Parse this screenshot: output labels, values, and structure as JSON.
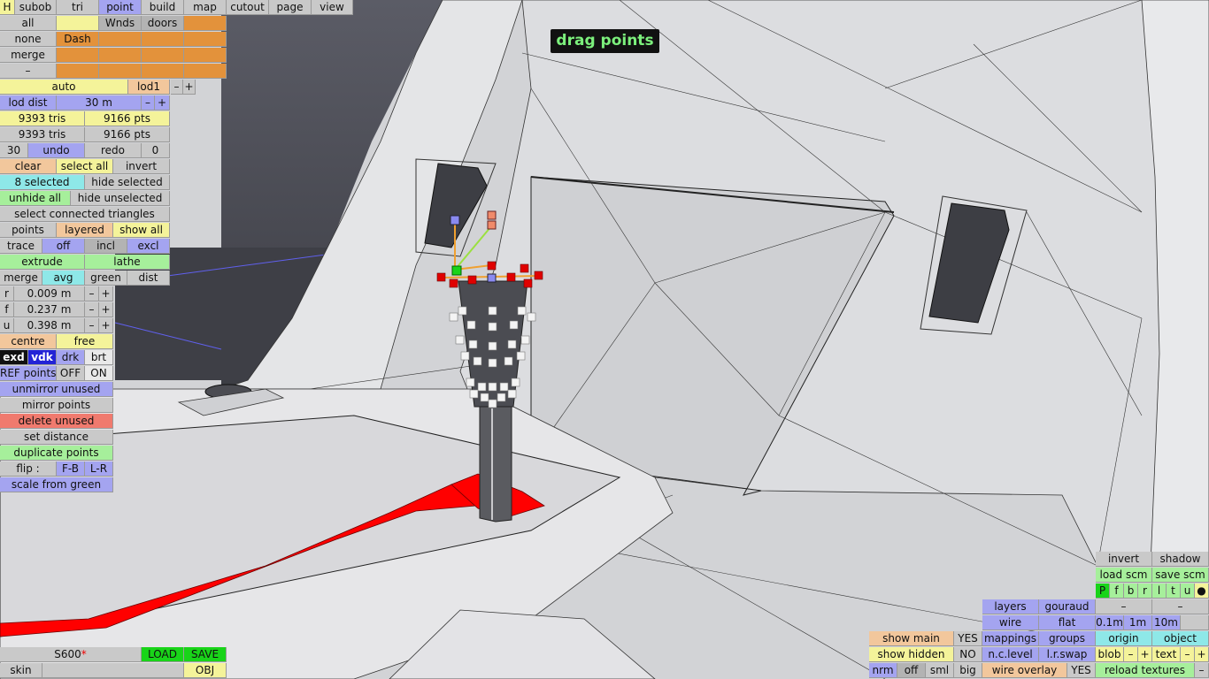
{
  "tabs": {
    "h": "H",
    "subob": "subob",
    "tri": "tri",
    "point": "point",
    "build": "build",
    "map": "map",
    "cutout": "cutout",
    "page": "page",
    "view": "view"
  },
  "selection_grid": {
    "all": "all",
    "wnds": "Wnds",
    "doors": "doors",
    "none": "none",
    "dash": "Dash",
    "merge": "merge",
    "dash_sym": "–"
  },
  "lod": {
    "auto": "auto",
    "lod1": "lod1",
    "minus": "–",
    "plus": "+",
    "lod_dist_label": "lod dist",
    "lod_dist_value": "30 m"
  },
  "stats": {
    "tris1": "9393 tris",
    "pts1": "9166 pts",
    "tris2": "9393 tris",
    "pts2": "9166 pts"
  },
  "history": {
    "count": "30",
    "undo": "undo",
    "redo": "redo",
    "zero": "0"
  },
  "select": {
    "clear": "clear",
    "select_all": "select all",
    "invert": "invert",
    "selected": "8 selected",
    "hide_selected": "hide selected",
    "unhide_all": "unhide all",
    "hide_unselected": "hide unselected",
    "select_connected": "select connected triangles"
  },
  "display": {
    "points": "points",
    "layered": "layered",
    "show_all": "show all",
    "trace": "trace",
    "off": "off",
    "incl": "incl",
    "excl": "excl"
  },
  "ops": {
    "extrude": "extrude",
    "lathe": "lathe",
    "merge": "merge",
    "avg": "avg",
    "green": "green",
    "dist": "dist"
  },
  "params": [
    {
      "label": "r",
      "value": "0.009 m"
    },
    {
      "label": "f",
      "value": "0.237 m"
    },
    {
      "label": "u",
      "value": "0.398 m"
    }
  ],
  "mode": {
    "centre": "centre",
    "free": "free",
    "exd": "exd",
    "vdk": "vdk",
    "drk": "drk",
    "brt": "brt",
    "ref_points": "REF points",
    "off": "OFF",
    "on": "ON"
  },
  "actions": {
    "unmirror_unused": "unmirror unused",
    "mirror_points": "mirror points",
    "delete_unused": "delete unused",
    "set_distance": "set distance",
    "duplicate_points": "duplicate points",
    "flip": "flip :",
    "fb": "F-B",
    "lr": "L-R",
    "scale_from_green": "scale from green"
  },
  "status_hint": "drag points",
  "file": {
    "name": "S600",
    "modified_mark": "*",
    "load": "LOAD",
    "save": "SAVE",
    "skin": "skin",
    "obj": "OBJ"
  },
  "right_panel": {
    "invert": "invert",
    "shadow": "shadow",
    "load_scm": "load scm",
    "save_scm": "save scm",
    "pfbrltu": [
      "P",
      "f",
      "b",
      "r",
      "l",
      "t",
      "u",
      "●"
    ],
    "layers": "layers",
    "gouraud": "gouraud",
    "dash1": "–",
    "dash2": "–",
    "wire": "wire",
    "flat": "flat",
    "d01": "0.1m",
    "d1": "1m",
    "d10": "10m",
    "show_main": "show main",
    "yes1": "YES",
    "mappings": "mappings",
    "groups": "groups",
    "origin": "origin",
    "object": "object",
    "show_hidden": "show hidden",
    "no": "NO",
    "nc_level": "n.c.level",
    "lr_swap": "l.r.swap",
    "blob": "blob",
    "text": "text",
    "minus": "–",
    "plus": "+",
    "nrm": "nrm",
    "off": "off",
    "sml": "sml",
    "big": "big",
    "wire_overlay": "wire overlay",
    "yes2": "YES",
    "reload_textures": "reload textures"
  },
  "colors": {
    "selected_point": "#e00000",
    "green_point": "#19d419",
    "mesh_highlight": "#ff0000"
  }
}
